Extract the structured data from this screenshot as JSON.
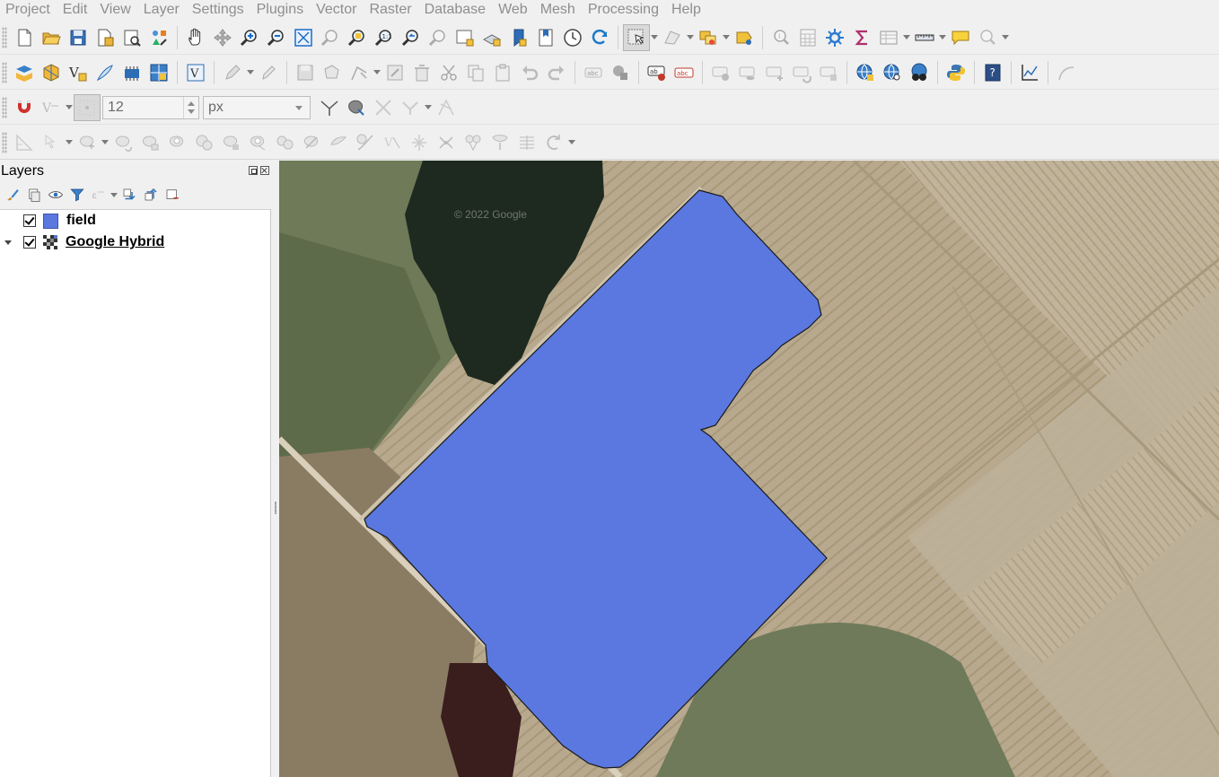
{
  "menu": [
    "Project",
    "Edit",
    "View",
    "Layer",
    "Settings",
    "Plugins",
    "Vector",
    "Raster",
    "Database",
    "Web",
    "Mesh",
    "Processing",
    "Help"
  ],
  "snapping": {
    "tolerance": "12",
    "unit": "px"
  },
  "layers_panel": {
    "title": "Layers",
    "layers": [
      {
        "name": "field",
        "visible": true,
        "type": "vector-polygon",
        "color": "#5a78e0"
      },
      {
        "name": "Google Hybrid",
        "visible": true,
        "type": "raster-tiles"
      }
    ]
  },
  "map": {
    "watermark": "© 2022 Google",
    "feature_fill": "#5a78e0",
    "feature_stroke": "#1a1a1a"
  }
}
